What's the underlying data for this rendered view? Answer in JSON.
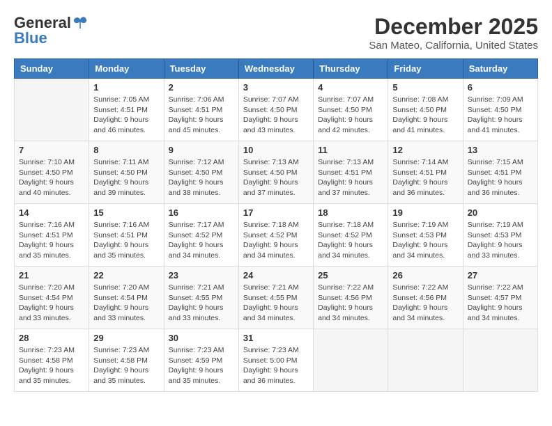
{
  "logo": {
    "general": "General",
    "blue": "Blue"
  },
  "title": "December 2025",
  "location": "San Mateo, California, United States",
  "days_of_week": [
    "Sunday",
    "Monday",
    "Tuesday",
    "Wednesday",
    "Thursday",
    "Friday",
    "Saturday"
  ],
  "weeks": [
    [
      {
        "day": "",
        "info": ""
      },
      {
        "day": "1",
        "info": "Sunrise: 7:05 AM\nSunset: 4:51 PM\nDaylight: 9 hours\nand 46 minutes."
      },
      {
        "day": "2",
        "info": "Sunrise: 7:06 AM\nSunset: 4:51 PM\nDaylight: 9 hours\nand 45 minutes."
      },
      {
        "day": "3",
        "info": "Sunrise: 7:07 AM\nSunset: 4:50 PM\nDaylight: 9 hours\nand 43 minutes."
      },
      {
        "day": "4",
        "info": "Sunrise: 7:07 AM\nSunset: 4:50 PM\nDaylight: 9 hours\nand 42 minutes."
      },
      {
        "day": "5",
        "info": "Sunrise: 7:08 AM\nSunset: 4:50 PM\nDaylight: 9 hours\nand 41 minutes."
      },
      {
        "day": "6",
        "info": "Sunrise: 7:09 AM\nSunset: 4:50 PM\nDaylight: 9 hours\nand 41 minutes."
      }
    ],
    [
      {
        "day": "7",
        "info": "Sunrise: 7:10 AM\nSunset: 4:50 PM\nDaylight: 9 hours\nand 40 minutes."
      },
      {
        "day": "8",
        "info": "Sunrise: 7:11 AM\nSunset: 4:50 PM\nDaylight: 9 hours\nand 39 minutes."
      },
      {
        "day": "9",
        "info": "Sunrise: 7:12 AM\nSunset: 4:50 PM\nDaylight: 9 hours\nand 38 minutes."
      },
      {
        "day": "10",
        "info": "Sunrise: 7:13 AM\nSunset: 4:50 PM\nDaylight: 9 hours\nand 37 minutes."
      },
      {
        "day": "11",
        "info": "Sunrise: 7:13 AM\nSunset: 4:51 PM\nDaylight: 9 hours\nand 37 minutes."
      },
      {
        "day": "12",
        "info": "Sunrise: 7:14 AM\nSunset: 4:51 PM\nDaylight: 9 hours\nand 36 minutes."
      },
      {
        "day": "13",
        "info": "Sunrise: 7:15 AM\nSunset: 4:51 PM\nDaylight: 9 hours\nand 36 minutes."
      }
    ],
    [
      {
        "day": "14",
        "info": "Sunrise: 7:16 AM\nSunset: 4:51 PM\nDaylight: 9 hours\nand 35 minutes."
      },
      {
        "day": "15",
        "info": "Sunrise: 7:16 AM\nSunset: 4:51 PM\nDaylight: 9 hours\nand 35 minutes."
      },
      {
        "day": "16",
        "info": "Sunrise: 7:17 AM\nSunset: 4:52 PM\nDaylight: 9 hours\nand 34 minutes."
      },
      {
        "day": "17",
        "info": "Sunrise: 7:18 AM\nSunset: 4:52 PM\nDaylight: 9 hours\nand 34 minutes."
      },
      {
        "day": "18",
        "info": "Sunrise: 7:18 AM\nSunset: 4:52 PM\nDaylight: 9 hours\nand 34 minutes."
      },
      {
        "day": "19",
        "info": "Sunrise: 7:19 AM\nSunset: 4:53 PM\nDaylight: 9 hours\nand 34 minutes."
      },
      {
        "day": "20",
        "info": "Sunrise: 7:19 AM\nSunset: 4:53 PM\nDaylight: 9 hours\nand 33 minutes."
      }
    ],
    [
      {
        "day": "21",
        "info": "Sunrise: 7:20 AM\nSunset: 4:54 PM\nDaylight: 9 hours\nand 33 minutes."
      },
      {
        "day": "22",
        "info": "Sunrise: 7:20 AM\nSunset: 4:54 PM\nDaylight: 9 hours\nand 33 minutes."
      },
      {
        "day": "23",
        "info": "Sunrise: 7:21 AM\nSunset: 4:55 PM\nDaylight: 9 hours\nand 33 minutes."
      },
      {
        "day": "24",
        "info": "Sunrise: 7:21 AM\nSunset: 4:55 PM\nDaylight: 9 hours\nand 34 minutes."
      },
      {
        "day": "25",
        "info": "Sunrise: 7:22 AM\nSunset: 4:56 PM\nDaylight: 9 hours\nand 34 minutes."
      },
      {
        "day": "26",
        "info": "Sunrise: 7:22 AM\nSunset: 4:56 PM\nDaylight: 9 hours\nand 34 minutes."
      },
      {
        "day": "27",
        "info": "Sunrise: 7:22 AM\nSunset: 4:57 PM\nDaylight: 9 hours\nand 34 minutes."
      }
    ],
    [
      {
        "day": "28",
        "info": "Sunrise: 7:23 AM\nSunset: 4:58 PM\nDaylight: 9 hours\nand 35 minutes."
      },
      {
        "day": "29",
        "info": "Sunrise: 7:23 AM\nSunset: 4:58 PM\nDaylight: 9 hours\nand 35 minutes."
      },
      {
        "day": "30",
        "info": "Sunrise: 7:23 AM\nSunset: 4:59 PM\nDaylight: 9 hours\nand 35 minutes."
      },
      {
        "day": "31",
        "info": "Sunrise: 7:23 AM\nSunset: 5:00 PM\nDaylight: 9 hours\nand 36 minutes."
      },
      {
        "day": "",
        "info": ""
      },
      {
        "day": "",
        "info": ""
      },
      {
        "day": "",
        "info": ""
      }
    ]
  ]
}
